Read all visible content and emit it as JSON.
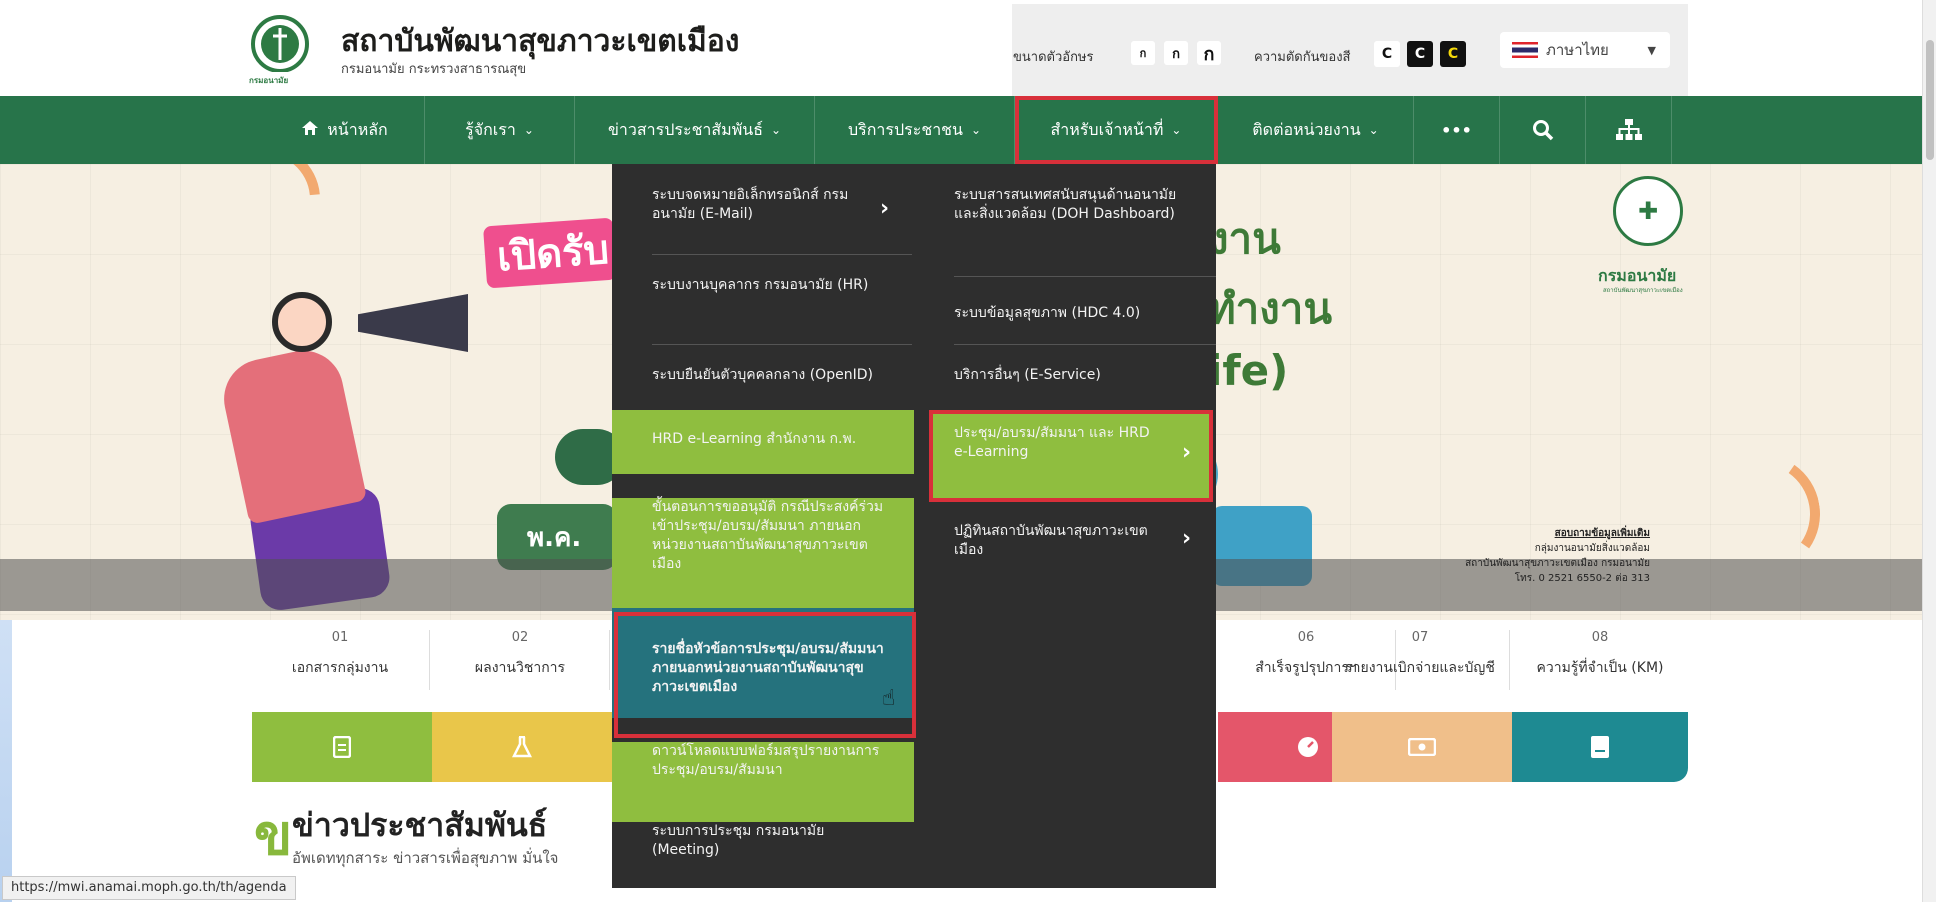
{
  "header": {
    "title": "สถาบันพัฒนาสุขภาวะเขตเมือง",
    "subtitle": "กรมอนามัย กระทรวงสาธารณสุข",
    "logo_caption": "กรมอนามัย",
    "font_size_label": "ขนาดตัวอักษร",
    "font_buttons": [
      "ก",
      "ก",
      "ก"
    ],
    "contrast_label": "ความตัดกันของสี",
    "contrast_buttons": [
      "C",
      "C",
      "C"
    ],
    "language": "ภาษาไทย"
  },
  "nav": {
    "items": [
      {
        "label": "หน้าหลัก",
        "icon": "home-icon"
      },
      {
        "label": "รู้จักเรา",
        "icon": "chevron-down-icon"
      },
      {
        "label": "ข่าวสารประชาสัมพันธ์",
        "icon": "chevron-down-icon"
      },
      {
        "label": "บริการประชาชน",
        "icon": "chevron-down-icon"
      },
      {
        "label": "สำหรับเจ้าหน้าที่",
        "icon": "chevron-down-icon"
      },
      {
        "label": "ติดต่อหน่วยงาน",
        "icon": "chevron-down-icon"
      },
      {
        "label": "•••",
        "icon": "more-icon"
      },
      {
        "label": "",
        "icon": "search-icon"
      },
      {
        "label": "",
        "icon": "sitemap-icon"
      }
    ]
  },
  "hero": {
    "open_tag": "เปิดรับ",
    "right_line1": "งาน",
    "right_line2": "ทำงาน",
    "right_line3": "ife)",
    "pill_text": "พ.ค.",
    "dept_name": "กรมอนามัย",
    "dept_sub": "สถาบันพัฒนาสุขภาวะเขตเมือง",
    "contact": {
      "line1": "สอบถามข้อมูลเพิ่มเติม",
      "line2": "กลุ่มงานอนามัยสิ่งแวดล้อม",
      "line3": "สถาบันพัฒนาสุขภาวะเขตเมือง กรมอนามัย",
      "line4": "โทร. 0 2521 6550-2 ต่อ 313"
    }
  },
  "stats": [
    {
      "num": "01",
      "label": "เอกสารกลุ่มงาน"
    },
    {
      "num": "02",
      "label": "ผลงานวิชาการ"
    },
    {
      "num": "06",
      "label": "สำเร็จรูปรุปการฯ"
    },
    {
      "num": "07",
      "label": "รายงานเบิกจ่ายและบัญชี"
    },
    {
      "num": "08",
      "label": "ความรู้ที่จำเป็น (KM)"
    }
  ],
  "tiles": [
    {
      "icon": "document-icon",
      "color": "#8fbe3f"
    },
    {
      "icon": "flask-icon",
      "color": "#e9c64a"
    },
    {
      "icon": "gauge-icon",
      "color": "#e4566a"
    },
    {
      "icon": "money-icon",
      "color": "#f0bf8a"
    },
    {
      "icon": "book-icon",
      "color": "#1e8a92"
    }
  ],
  "news": {
    "title": "ข่าวประชาสัมพันธ์",
    "mark": "ข",
    "subtitle": "อัพเดททุกสาระ ข่าวสารเพื่อสุขภาพ มั่นใจ"
  },
  "dropdown": {
    "left": [
      "ระบบจดหมายอิเล็กทรอนิกส์ กรมอนามัย (E-Mail)",
      "ระบบงานบุคลากร กรมอนามัย (HR)",
      "ระบบยืนยันตัวบุคคลกลาง (OpenID)",
      "HRD e-Learning สำนักงาน ก.พ.",
      "ขั้นตอนการขออนุมัติ กรณีประสงค์ร่วมเข้าประชุม/อบรม/สัมมนา ภายนอกหน่วยงานสถาบันพัฒนาสุขภาวะเขตเมือง",
      "รายชื่อหัวข้อการประชุม/อบรม/สัมมนา ภายนอกหน่วยงานสถาบันพัฒนาสุขภาวะเขตเมือง",
      "ดาวน์โหลดแบบฟอร์มสรุปรายงานการประชุม/อบรม/สัมมนา",
      "ระบบการประชุม กรมอนามัย (Meeting)"
    ],
    "right": [
      "ระบบสารสนเทศสนับสนุนด้านอนามัยและสิ่งแวดล้อม (DOH Dashboard)",
      "ระบบข้อมูลสุขภาพ (HDC 4.0)",
      "บริการอื่นๆ (E-Service)",
      "ประชุม/อบรม/สัมมนา และ HRD e-Learning",
      "ปฏิทินสถาบันพัฒนาสุขภาวะเขตเมือง"
    ]
  },
  "statusbar": "https://mwi.anamai.moph.go.th/th/agenda",
  "colors": {
    "nav": "#27744a",
    "menu_bg": "#2e2e2e",
    "menu_green": "#8fbe3f",
    "menu_teal": "#25727d",
    "highlight": "#d8303a"
  }
}
